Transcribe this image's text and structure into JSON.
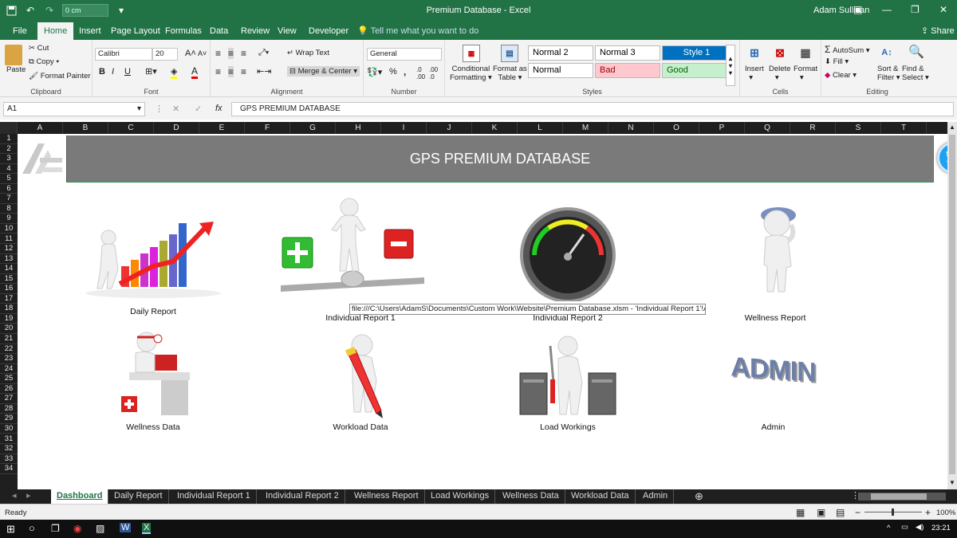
{
  "titlebar": {
    "qat_input": "0 cm",
    "title": "Premium Database  -  Excel",
    "user": "Adam Sullivan",
    "minimize": "—",
    "maximize": "❐",
    "close": "✕"
  },
  "ribbon_tabs": [
    "File",
    "Home",
    "Insert",
    "Page Layout",
    "Formulas",
    "Data",
    "Review",
    "View",
    "Developer"
  ],
  "tell_me": "Tell me what you want to do",
  "share": "Share",
  "clipboard": {
    "paste": "Paste",
    "cut": "Cut",
    "copy": "Copy",
    "format_painter": "Format Painter",
    "label": "Clipboard"
  },
  "font": {
    "name": "Calibri",
    "size": "20",
    "bold": "B",
    "italic": "I",
    "underline": "U",
    "label": "Font"
  },
  "alignment": {
    "wrap_text": "Wrap Text",
    "merge_center": "Merge & Center",
    "label": "Alignment"
  },
  "number": {
    "format": "General",
    "percent": "%",
    "comma": ",",
    "label": "Number"
  },
  "styles": {
    "conditional": "Conditional\nFormatting",
    "conditional_l1": "Conditional",
    "conditional_l2": "Formatting",
    "format_table_l1": "Format as",
    "format_table_l2": "Table",
    "cells": [
      {
        "name": "Normal 2",
        "bg": "#ffffff",
        "fg": "#000000"
      },
      {
        "name": "Normal 3",
        "bg": "#ffffff",
        "fg": "#000000"
      },
      {
        "name": "Style 1",
        "bg": "#0070c0",
        "fg": "#ffffff"
      },
      {
        "name": "Normal",
        "bg": "#ffffff",
        "fg": "#000000"
      },
      {
        "name": "Bad",
        "bg": "#ffc7ce",
        "fg": "#9c0006"
      },
      {
        "name": "Good",
        "bg": "#c6efce",
        "fg": "#006100"
      }
    ],
    "label": "Styles"
  },
  "cells_group": {
    "insert": "Insert",
    "delete": "Delete",
    "format": "Format",
    "label": "Cells"
  },
  "editing": {
    "autosum": "AutoSum",
    "fill": "Fill",
    "clear": "Clear",
    "sort_l1": "Sort &",
    "sort_l2": "Filter",
    "find_l1": "Find &",
    "find_l2": "Select",
    "label": "Editing"
  },
  "formula_bar": {
    "name_box": "A1",
    "fx": "fx",
    "content": "GPS PREMIUM DATABASE"
  },
  "columns": [
    "A",
    "B",
    "C",
    "D",
    "E",
    "F",
    "G",
    "H",
    "I",
    "J",
    "K",
    "L",
    "M",
    "N",
    "O",
    "P",
    "Q",
    "R",
    "S",
    "T"
  ],
  "rows": [
    "1",
    "2",
    "3",
    "4",
    "5",
    "6",
    "7",
    "8",
    "9",
    "10",
    "11",
    "12",
    "13",
    "14",
    "15",
    "16",
    "17",
    "18",
    "19",
    "20",
    "21",
    "22",
    "23",
    "24",
    "25",
    "26",
    "27",
    "28",
    "29",
    "30",
    "31",
    "32",
    "33",
    "34"
  ],
  "banner_title": "GPS PREMIUM DATABASE",
  "tiles": [
    {
      "label": "Daily Report"
    },
    {
      "label": "Individual Report 1"
    },
    {
      "label": "Individual Report 2"
    },
    {
      "label": "Wellness Report"
    },
    {
      "label": "Wellness Data"
    },
    {
      "label": "Workload Data"
    },
    {
      "label": "Load Workings"
    },
    {
      "label": "Admin"
    }
  ],
  "admin_logo_text": "ADMIN",
  "tooltip": "file:///C:\\Users\\AdamS\\Documents\\Custom Work\\Website\\Premium Database.xlsm - 'Individual Report 1'!A1",
  "sheet_tabs": [
    "Dashboard",
    "Daily Report",
    "Individual Report 1",
    "Individual Report 2",
    "Wellness Report",
    "Load Workings",
    "Wellness Data",
    "Workload Data",
    "Admin"
  ],
  "status": {
    "ready": "Ready",
    "zoom": "100%"
  },
  "taskbar": {
    "time": "23:21"
  }
}
